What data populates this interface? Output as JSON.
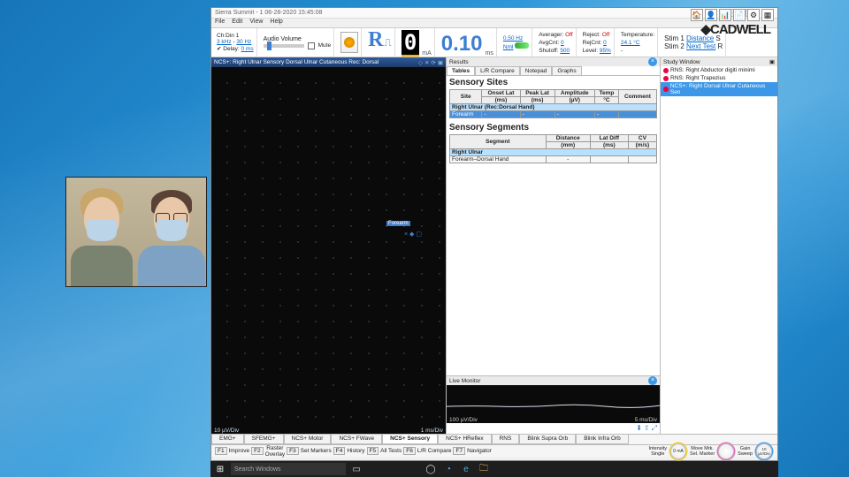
{
  "window": {
    "title": "Sierra Summit - 1  06-28-2020 15:45:08"
  },
  "menu": [
    "File",
    "Edit",
    "View",
    "Help"
  ],
  "toolbar": {
    "channel": "Ch:Din 1",
    "freq_lo": "3 kHz",
    "freq_hi": "30 Hz",
    "delay_label": "Delay:",
    "delay_val": "0 ms",
    "audio_label": "Audio Volume",
    "mute": "Mute",
    "r": "R",
    "zero": "0",
    "zero_unit": "mA",
    "val": "0.10",
    "val_unit": "ms",
    "hz": "0.50 Hz",
    "nml": "Nml",
    "avg": {
      "averager": "Averager:",
      "avgcnt": "AvgCnt:",
      "shutoff": "Shutoff:",
      "off": "Off",
      "z": "0",
      "five": "500"
    },
    "rej": {
      "reject": "Reject:",
      "rejcnt": "RejCnt:",
      "level": "Level:",
      "off": "Off",
      "z": "0",
      "pct": "95%"
    },
    "temp": {
      "label": "Temperature:",
      "val": "24.1 °C",
      "dash": "-"
    },
    "stim1": "Stim 1",
    "stim2": "Stim 2",
    "distance": "Distance",
    "next": "Next Test",
    "s": "S"
  },
  "brand": "CADWELL",
  "trace": {
    "title": "NCS+: Right Ulnar Sensory  Dorsal Ulnar Cutaneous  Rec: Dorsal",
    "marker": "Forearm",
    "yscale": "10 µV/Div",
    "xscale": "1 ms/Div"
  },
  "results": {
    "header": "Results",
    "tabs": [
      "Tables",
      "L/R Compare",
      "Notepad",
      "Graphs"
    ],
    "sites_title": "Sensory Sites",
    "sites_heads": {
      "site": "Site",
      "onset": "Onset Lat",
      "peak": "Peak Lat",
      "amp": "Amplitude",
      "temp": "Temp",
      "comment": "Comment",
      "ms": "(ms)",
      "uv": "(µV)",
      "c": "°C"
    },
    "site_name": "Right Ulnar (Rec:Dorsal Hand)",
    "site_row": "Forearm",
    "segs_title": "Sensory Segments",
    "segs_heads": {
      "segment": "Segment",
      "distance": "Distance",
      "latdiff": "Lat Diff",
      "cv": "CV",
      "mm": "(mm)",
      "ms": "(ms)",
      "mps": "(m/s)"
    },
    "seg_name": "Right Ulnar",
    "seg_row": "Forearm–Dorsal Hand"
  },
  "live": {
    "header": "Live Monitor",
    "yscale": "100 µV/Div",
    "xscale": "5 ms/Div"
  },
  "studies": {
    "header": "Study Window",
    "items": [
      "RNS: Right Abductor digiti minimi",
      "RNS: Right Trapezius",
      "NCS+: Right Dorsal Ulnar Cutaneous Sen"
    ]
  },
  "bottom_tabs": [
    "EMG+",
    "SFEMG+",
    "NCS+ Motor",
    "NCS+ FWave",
    "NCS+ Sensory",
    "NCS+ HReflex",
    "RNS",
    "Blink Supra Orb",
    "Blink Infra Orb"
  ],
  "fn": {
    "f1": "Improve",
    "f2a": "Raster",
    "f2b": "Overlay",
    "f3": "Set Markers",
    "f4": "History",
    "f5": "All Tests",
    "f6": "L/R Compare",
    "f7": "Navigator",
    "k1a": "Intensity",
    "k1b": "Single",
    "k1v": "0 mA",
    "k2a": "Move Mrk.",
    "k2b": "Sel. Marker",
    "k3a": "Gain",
    "k3b": "Sweep",
    "k3v": "10\nµV/Div"
  },
  "taskbar": {
    "search": "Search Windows"
  }
}
